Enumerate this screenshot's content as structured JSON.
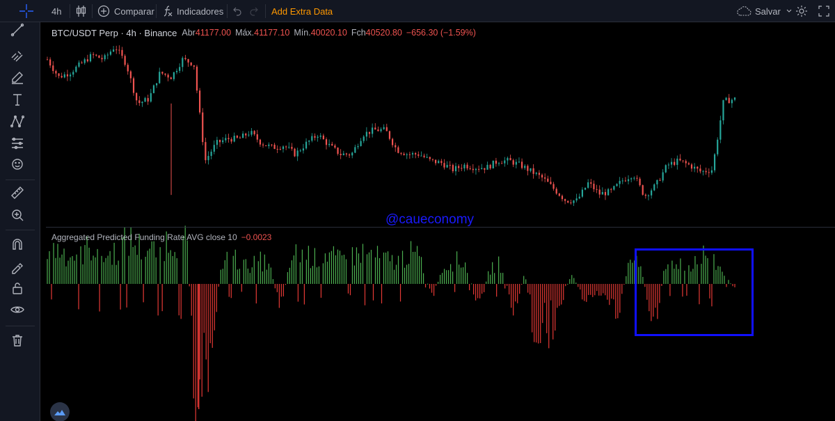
{
  "toolbar": {
    "interval": "4h",
    "compare_label": "Comparar",
    "indicators_label": "Indicadores",
    "extra_data_label": "Add Extra Data",
    "save_label": "Salvar"
  },
  "legend": {
    "symbol": "BTC/USDT Perp · 4h · Binance",
    "open_label": "Abr",
    "open_value": "41177.00",
    "high_label": "Máx.",
    "high_value": "41177.10",
    "low_label": "Mín.",
    "low_value": "40020.10",
    "close_label": "Fch",
    "close_value": "40520.80",
    "change_value": "−656.30 (−1.59%)"
  },
  "indicator": {
    "name": "Aggregated Predicted Funding Rate AVG close 10",
    "value": "−0.0023"
  },
  "watermark": "@caueconomy",
  "colors": {
    "up": "#26a69a",
    "down": "#ef5350",
    "bar_up": "#4caf50",
    "bar_down": "#e53935",
    "highlight": "#1010ff",
    "accent": "#ff9800"
  },
  "chart_data": [
    {
      "type": "line",
      "series_style": "candlestick",
      "series": [
        {
          "values": [
            41600,
            41200,
            41300,
            41500,
            41700,
            41600,
            41900,
            41500,
            40600,
            40700,
            41300,
            41200,
            41600,
            41500,
            39300,
            39700,
            39800,
            39800,
            39950,
            39700,
            39600,
            39650,
            39450,
            39700,
            39900,
            39650,
            39450,
            39450,
            39900,
            40000,
            40000,
            39550,
            39450,
            39450,
            39300,
            39250,
            39100,
            39200,
            39150,
            39150,
            39300,
            39300,
            39200,
            39050,
            38900,
            38650,
            38400,
            38400,
            38800,
            38550,
            38600,
            38850,
            39000,
            38500,
            38750,
            39200,
            39300,
            39200,
            39050,
            39100,
            40650,
            40700
          ]
        }
      ]
    },
    {
      "type": "bar",
      "title": "Aggregated Predicted Funding Rate AVG close 10",
      "series": [
        {
          "values": [
            0.0021,
            0.0024,
            0.0019,
            0.0022,
            0.0026,
            0.0018,
            0.0023,
            0.003,
            0.0025,
            0.0022,
            0.0028,
            0.0032,
            0.0027,
            -0.012,
            -0.0046,
            0.0015,
            0.0018,
            0.0012,
            0.0016,
            0.0014,
            -0.0016,
            0.0019,
            0.0022,
            0.0017,
            0.0021,
            0.0016,
            0.0018,
            0.0022,
            0.0019,
            0.0017,
            0.0015,
            0.0021,
            0.0018,
            -0.001,
            0.0012,
            0.0016,
            0.0013,
            -0.0018,
            0.0011,
            0.0014,
            -0.0022,
            0.0009,
            -0.0048,
            -0.0034,
            -0.0015,
            0.0008,
            -0.0011,
            -0.0006,
            -0.0012,
            -0.0019,
            0.0019,
            0.0009,
            -0.0033,
            0.0011,
            0.0016,
            0.0012,
            0.0021,
            0.0018,
            0.0008,
            -0.0004
          ]
        }
      ]
    }
  ]
}
